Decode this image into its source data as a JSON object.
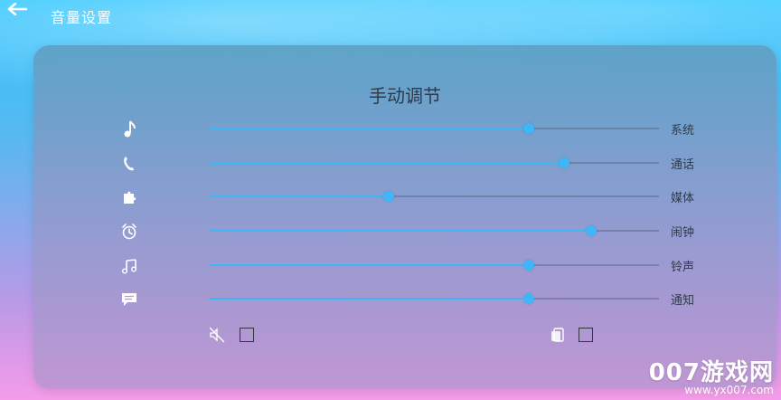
{
  "header": {
    "title": "音量设置",
    "back_icon": "back-arrow-icon"
  },
  "panel": {
    "title": "手动调节",
    "sliders": [
      {
        "key": "system",
        "label": "系统",
        "value": 0.71,
        "icon": "music-note-icon"
      },
      {
        "key": "call",
        "label": "通话",
        "value": 0.79,
        "icon": "phone-icon"
      },
      {
        "key": "media",
        "label": "媒体",
        "value": 0.4,
        "icon": "puzzle-icon"
      },
      {
        "key": "alarm",
        "label": "闹钟",
        "value": 0.85,
        "icon": "alarm-clock-icon"
      },
      {
        "key": "ringtone",
        "label": "铃声",
        "value": 0.71,
        "icon": "music-notes-icon"
      },
      {
        "key": "notification",
        "label": "通知",
        "value": 0.71,
        "icon": "message-icon"
      }
    ],
    "checkboxes": {
      "mute": {
        "checked": false,
        "icon": "mute-icon"
      },
      "vibrate": {
        "checked": false,
        "icon": "vibrate-icon"
      }
    }
  },
  "colors": {
    "accent": "#3bb8f5",
    "track": "#5a6e8c",
    "text_dark": "#2e3a4a"
  },
  "watermark": {
    "main": "007游戏网",
    "url": "www.yx007.com"
  }
}
